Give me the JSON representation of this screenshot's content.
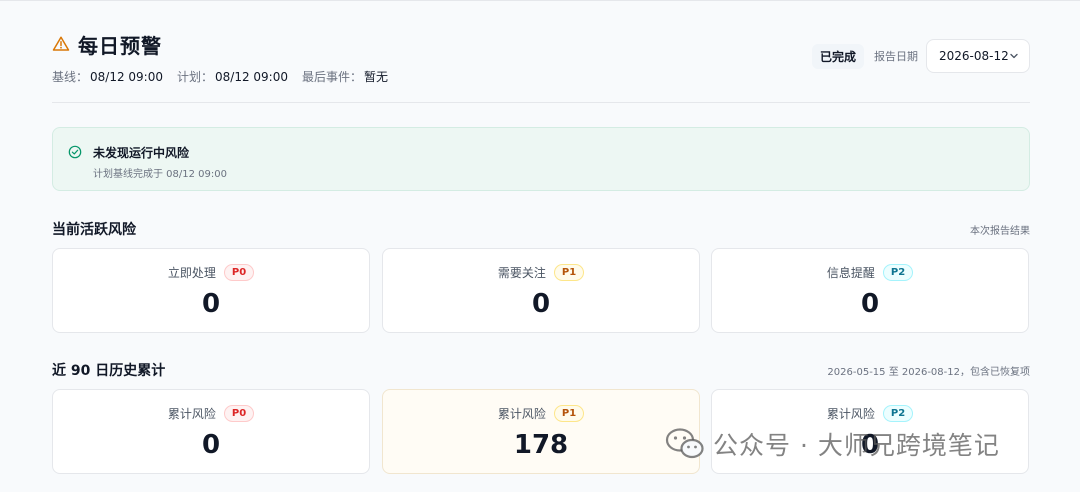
{
  "header": {
    "title": "每日预警",
    "meta": [
      {
        "label": "基线：",
        "value": "08/12 09:00"
      },
      {
        "label": "计划：",
        "value": "08/12 09:00"
      },
      {
        "label": "最后事件：",
        "value": "暂无"
      }
    ],
    "status": "已完成",
    "report_date_label": "报告日期",
    "report_date_value": "2026-08-12"
  },
  "alert": {
    "title": "未发现运行中风险",
    "subtitle": "计划基线完成于 08/12 09:00"
  },
  "current": {
    "title": "当前活跃风险",
    "note": "本次报告结果",
    "cards": [
      {
        "label": "立即处理",
        "level": "P0",
        "value": "0"
      },
      {
        "label": "需要关注",
        "level": "P1",
        "value": "0"
      },
      {
        "label": "信息提醒",
        "level": "P2",
        "value": "0"
      }
    ]
  },
  "history": {
    "title": "近 90 日历史累计",
    "note": "2026-05-15 至 2026-08-12，包含已恢复项",
    "cards": [
      {
        "label": "累计风险",
        "level": "P0",
        "value": "0"
      },
      {
        "label": "累计风险",
        "level": "P1",
        "value": "178"
      },
      {
        "label": "累计风险",
        "level": "P2",
        "value": "0"
      }
    ]
  },
  "watermark": {
    "text": "公众号 · 大师兄跨境笔记"
  },
  "colors": {
    "p0": "#dc2626",
    "p1": "#b45309",
    "p2": "#0e7490",
    "alert_bg": "#edf7f3",
    "success": "#059669",
    "warning": "#d97706"
  }
}
